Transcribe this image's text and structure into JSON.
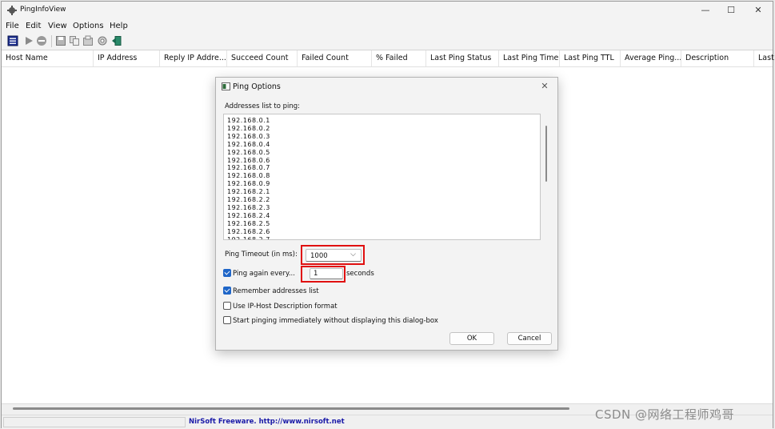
{
  "app": {
    "title": "PingInfoView"
  },
  "window_controls": {
    "minimize": "—",
    "maximize": "☐",
    "close": "✕"
  },
  "menu": [
    "File",
    "Edit",
    "View",
    "Options",
    "Help"
  ],
  "columns": [
    "Host Name",
    "IP Address",
    "Reply IP Addre...",
    "Succeed Count",
    "Failed Count",
    "% Failed",
    "Last Ping Status",
    "Last Ping Time",
    "Last Ping TTL",
    "Average Ping...",
    "Description",
    "Last"
  ],
  "status": {
    "link": "NirSoft Freeware.  http://www.nirsoft.net"
  },
  "dialog": {
    "title": "Ping Options",
    "close": "✕",
    "addresses_label": "Addresses list to ping:",
    "addresses": [
      "192.168.0.1",
      "192.168.0.2",
      "192.168.0.3",
      "192.168.0.4",
      "192.168.0.5",
      "192.168.0.6",
      "192.168.0.7",
      "192.168.0.8",
      "192.168.0.9",
      "192.168.2.1",
      "192.168.2.2",
      "192.168.2.3",
      "192.168.2.4",
      "192.168.2.5",
      "192.168.2.6",
      "192.168.2.7"
    ],
    "timeout_label": "Ping Timeout (in ms):",
    "timeout_value": "1000",
    "ping_again_label": "Ping again every...",
    "ping_again_checked": true,
    "ping_again_value": "1",
    "seconds_label": "seconds",
    "remember_label": "Remember addresses list",
    "remember_checked": true,
    "use_iphost_label": "Use IP-Host Description format",
    "use_iphost_checked": false,
    "start_immediately_label": "Start pinging immediately without displaying this dialog-box",
    "start_immediately_checked": false,
    "ok_label": "OK",
    "cancel_label": "Cancel"
  },
  "watermark": "CSDN @网络工程师鸡哥",
  "colors": {
    "accent": "#1f66c8",
    "highlight": "#e01010",
    "link": "#1a1aa8"
  },
  "icons": [
    "app-icon",
    "properties-icon",
    "play-icon",
    "stop-icon",
    "save-icon",
    "copy-icon",
    "html-report-icon",
    "options-icon",
    "exit-icon",
    "dialog-icon",
    "chevron-down-icon"
  ]
}
